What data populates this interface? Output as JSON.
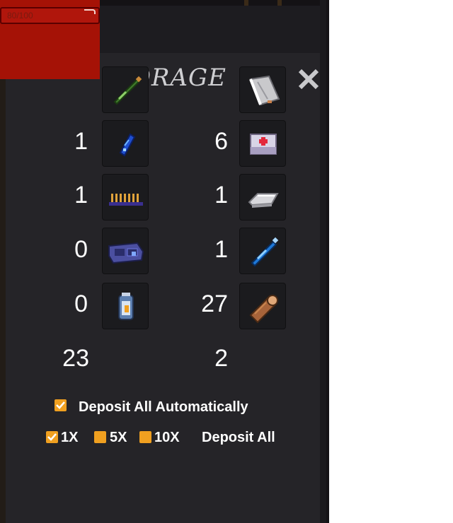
{
  "panel": {
    "title": "STORAGE"
  },
  "health": {
    "text": "80/100",
    "fraction": 0.8
  },
  "left_column": [
    {
      "icon": "green-bottle-icon",
      "count": "1"
    },
    {
      "icon": "blue-crystal-icon",
      "count": "1"
    },
    {
      "icon": "spikes-strip-icon",
      "count": "0"
    },
    {
      "icon": "circuit-device-icon",
      "count": "0"
    },
    {
      "icon": "battery-cell-icon",
      "count": "23"
    }
  ],
  "right_column": [
    {
      "icon": "paper-roll-icon",
      "count": "6"
    },
    {
      "icon": "medkit-icon",
      "count": "1"
    },
    {
      "icon": "metal-ingot-icon",
      "count": "1"
    },
    {
      "icon": "blue-vial-icon",
      "count": "27"
    },
    {
      "icon": "wood-log-icon",
      "count": "2"
    }
  ],
  "options": {
    "auto_deposit_label": "Deposit All Automatically",
    "auto_deposit_checked": true,
    "multipliers": [
      {
        "label": "1X",
        "checked": true
      },
      {
        "label": "5X",
        "checked": false
      },
      {
        "label": "10X",
        "checked": false
      }
    ],
    "deposit_all_label": "Deposit All"
  },
  "colors": {
    "panel": "#252428",
    "checkbox": "#f0a020",
    "health": "#a51206"
  }
}
